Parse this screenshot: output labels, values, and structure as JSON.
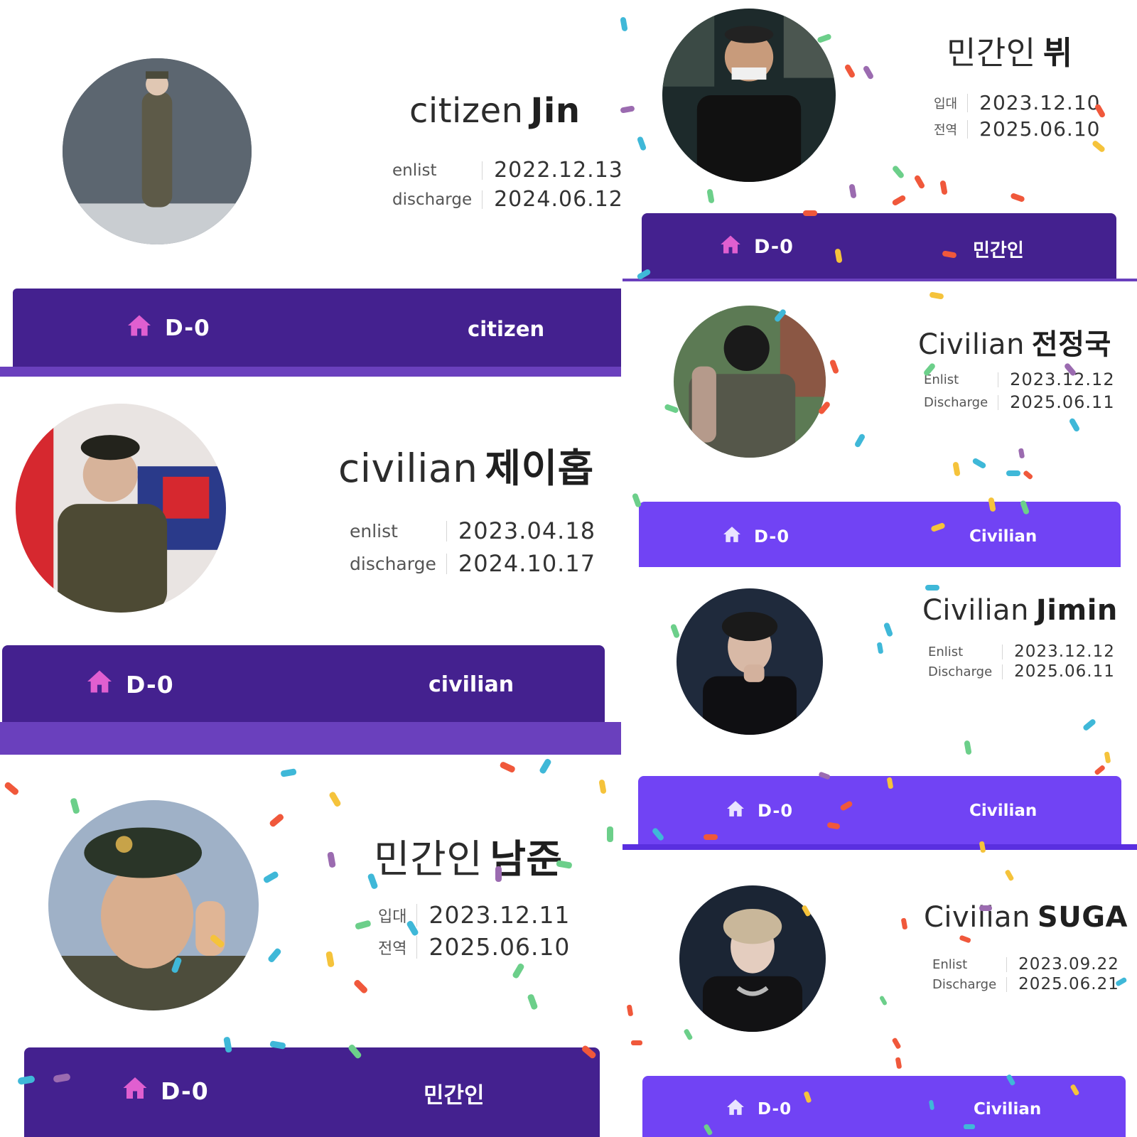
{
  "colors": {
    "bar_dark": "#44218f",
    "bar_dark_under": "#6a40bd",
    "bar_light": "#7143f4",
    "house_pink": "#e05fd0"
  },
  "icons": {
    "dday": "house-icon"
  },
  "cards": [
    {
      "id": "jin",
      "title_prefix": "citizen",
      "title_name": "Jin",
      "enlist_label": "enlist",
      "enlist_date": "2022.12.13",
      "discharge_label": "discharge",
      "discharge_date": "2024.06.12",
      "dday": "D-0",
      "status": "citizen"
    },
    {
      "id": "jhope",
      "title_prefix": "civilian",
      "title_name": "제이홉",
      "enlist_label": "enlist",
      "enlist_date": "2023.04.18",
      "discharge_label": "discharge",
      "discharge_date": "2024.10.17",
      "dday": "D-0",
      "status": "civilian"
    },
    {
      "id": "rm",
      "title_prefix": "민간인",
      "title_name": "남준",
      "enlist_label": "입대",
      "enlist_date": "2023.12.11",
      "discharge_label": "전역",
      "discharge_date": "2025.06.10",
      "dday": "D-0",
      "status": "민간인"
    },
    {
      "id": "v",
      "title_prefix": "민간인",
      "title_name": "뷔",
      "enlist_label": "입대",
      "enlist_date": "2023.12.10",
      "discharge_label": "전역",
      "discharge_date": "2025.06.10",
      "dday": "D-0",
      "status": "민간인"
    },
    {
      "id": "jk",
      "title_prefix": "Civilian",
      "title_name": "전정국",
      "enlist_label": "Enlist",
      "enlist_date": "2023.12.12",
      "discharge_label": "Discharge",
      "discharge_date": "2025.06.11",
      "dday": "D-0",
      "status": "Civilian"
    },
    {
      "id": "jimin",
      "title_prefix": "Civilian",
      "title_name": "Jimin",
      "enlist_label": "Enlist",
      "enlist_date": "2023.12.12",
      "discharge_label": "Discharge",
      "discharge_date": "2025.06.11",
      "dday": "D-0",
      "status": "Civilian"
    },
    {
      "id": "suga",
      "title_prefix": "Civilian",
      "title_name": "SUGA",
      "enlist_label": "Enlist",
      "enlist_date": "2023.09.22",
      "discharge_label": "Discharge",
      "discharge_date": "2025.06.21",
      "dday": "D-0",
      "status": "Civilian"
    }
  ]
}
